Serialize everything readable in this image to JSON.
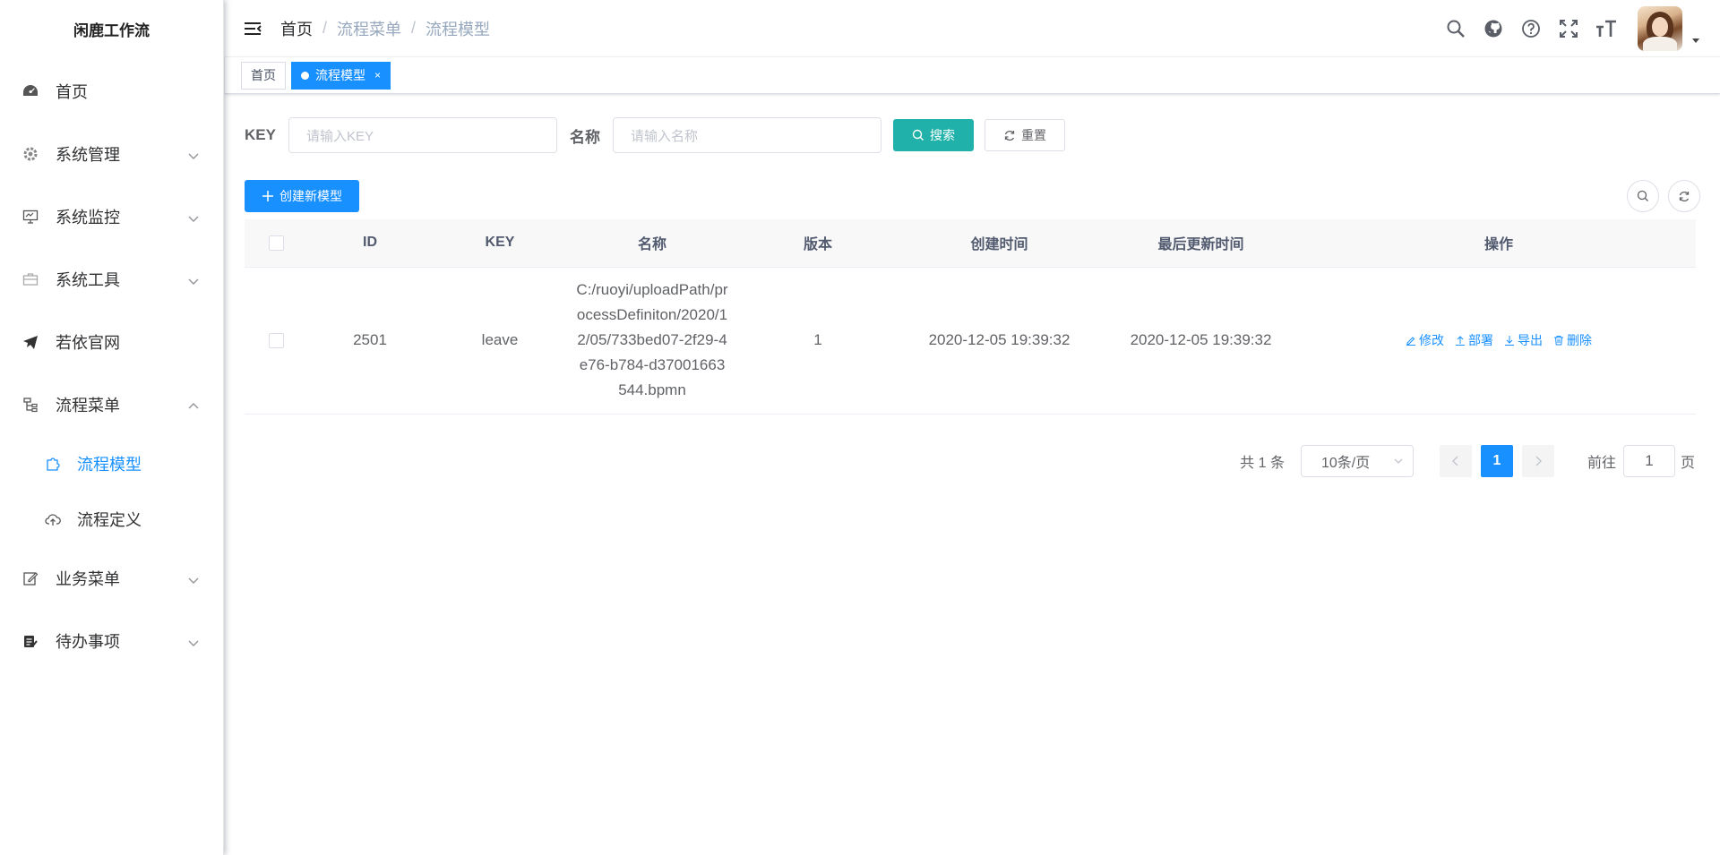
{
  "app": {
    "title": "闲鹿工作流"
  },
  "sidebar": {
    "items": [
      {
        "label": "首页",
        "icon": "dashboard-icon"
      },
      {
        "label": "系统管理",
        "icon": "gear-icon"
      },
      {
        "label": "系统监控",
        "icon": "monitor-icon"
      },
      {
        "label": "系统工具",
        "icon": "toolbox-icon"
      },
      {
        "label": "若依官网",
        "icon": "paper-plane-icon"
      },
      {
        "label": "流程菜单",
        "icon": "flow-icon"
      },
      {
        "label": "业务菜单",
        "icon": "edit-icon"
      },
      {
        "label": "待办事项",
        "icon": "todo-icon"
      }
    ],
    "submenu": [
      {
        "label": "流程模型",
        "icon": "puzzle-icon"
      },
      {
        "label": "流程定义",
        "icon": "cloud-upload-icon"
      }
    ]
  },
  "header": {
    "breadcrumb": [
      "首页",
      "流程菜单",
      "流程模型"
    ],
    "separator": "/"
  },
  "tags": [
    {
      "label": "首页"
    },
    {
      "label": "流程模型",
      "close": "×"
    }
  ],
  "search": {
    "key_label": "KEY",
    "key_placeholder": "请输入KEY",
    "name_label": "名称",
    "name_placeholder": "请输入名称",
    "search_label": "搜索",
    "reset_label": "重置"
  },
  "toolbar": {
    "create_label": "创建新模型"
  },
  "table": {
    "columns": [
      "ID",
      "KEY",
      "名称",
      "版本",
      "创建时间",
      "最后更新时间",
      "操作"
    ],
    "rows": [
      {
        "id": "2501",
        "key": "leave",
        "name": "C:/ruoyi/uploadPath/processDefiniton/2020/12/05/733bed07-2f29-4e76-b784-d37001663544.bpmn",
        "version": "1",
        "created": "2020-12-05 19:39:32",
        "updated": "2020-12-05 19:39:32"
      }
    ],
    "actions": [
      "修改",
      "部署",
      "导出",
      "删除"
    ]
  },
  "pagination": {
    "total_text": "共 1 条",
    "page_size": "10条/页",
    "current_page": "1",
    "goto_label": "前往",
    "goto_value": "1",
    "page_unit": "页"
  },
  "colors": {
    "primary": "#1890ff",
    "search_button": "#20b2aa"
  }
}
